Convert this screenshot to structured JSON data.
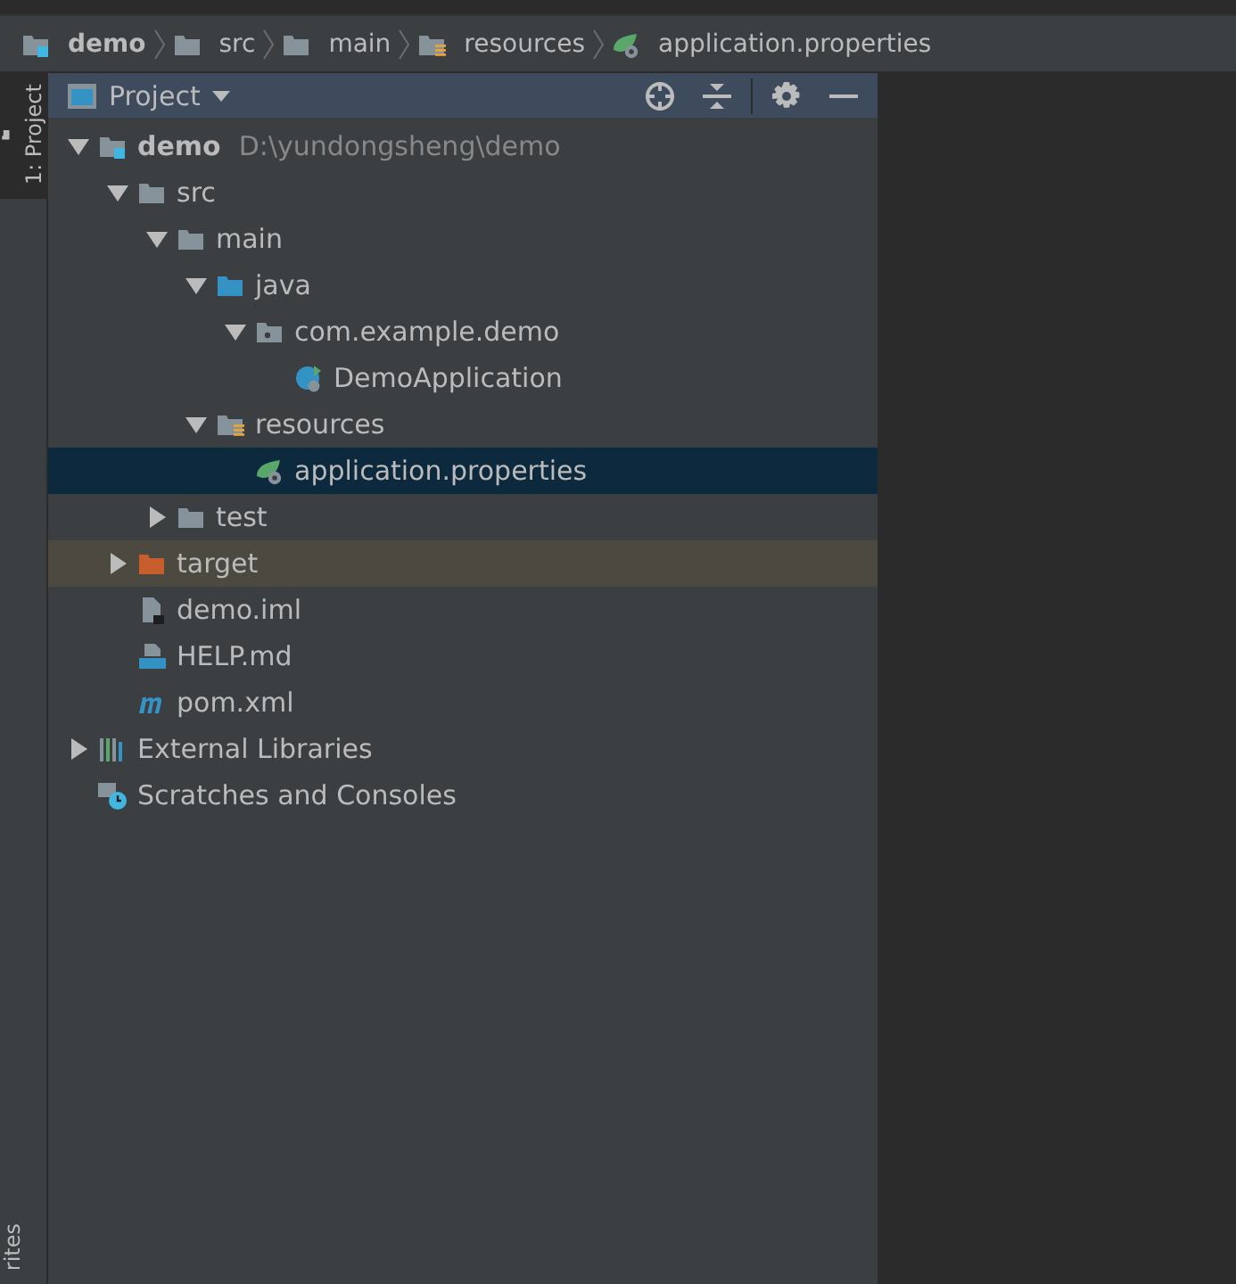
{
  "breadcrumbs": [
    {
      "label": "demo",
      "kind": "module"
    },
    {
      "label": "src",
      "kind": "folder"
    },
    {
      "label": "main",
      "kind": "folder"
    },
    {
      "label": "resources",
      "kind": "resource-folder"
    },
    {
      "label": "application.properties",
      "kind": "spring-properties"
    }
  ],
  "side_tabs": [
    {
      "label": "1: Project",
      "selected": true
    },
    {
      "label": "rites",
      "selected": false
    }
  ],
  "panel": {
    "title": "Project"
  },
  "tree": [
    {
      "label": "demo",
      "path": "D:\\yundongsheng\\demo",
      "kind": "module",
      "expanded": true,
      "selected": false,
      "children": [
        {
          "label": "src",
          "kind": "folder",
          "expanded": true,
          "selected": false,
          "children": [
            {
              "label": "main",
              "kind": "folder",
              "expanded": true,
              "selected": false,
              "children": [
                {
                  "label": "java",
                  "kind": "source-folder",
                  "expanded": true,
                  "selected": false,
                  "children": [
                    {
                      "label": "com.example.demo",
                      "kind": "package",
                      "expanded": true,
                      "selected": false,
                      "children": [
                        {
                          "label": "DemoApplication",
                          "kind": "spring-class",
                          "selected": false
                        }
                      ]
                    }
                  ]
                },
                {
                  "label": "resources",
                  "kind": "resource-folder",
                  "expanded": true,
                  "selected": false,
                  "children": [
                    {
                      "label": "application.properties",
                      "kind": "spring-properties",
                      "selected": true
                    }
                  ]
                }
              ]
            },
            {
              "label": "test",
              "kind": "folder",
              "expanded": false,
              "selected": false
            }
          ]
        },
        {
          "label": "target",
          "kind": "excluded-folder",
          "expanded": false,
          "selected": false
        },
        {
          "label": "demo.iml",
          "kind": "iml",
          "selected": false
        },
        {
          "label": "HELP.md",
          "kind": "markdown",
          "selected": false
        },
        {
          "label": "pom.xml",
          "kind": "maven",
          "selected": false
        }
      ]
    },
    {
      "label": "External Libraries",
      "kind": "libraries",
      "expanded": false,
      "selected": false
    },
    {
      "label": "Scratches and Consoles",
      "kind": "scratches",
      "selected": false
    }
  ]
}
